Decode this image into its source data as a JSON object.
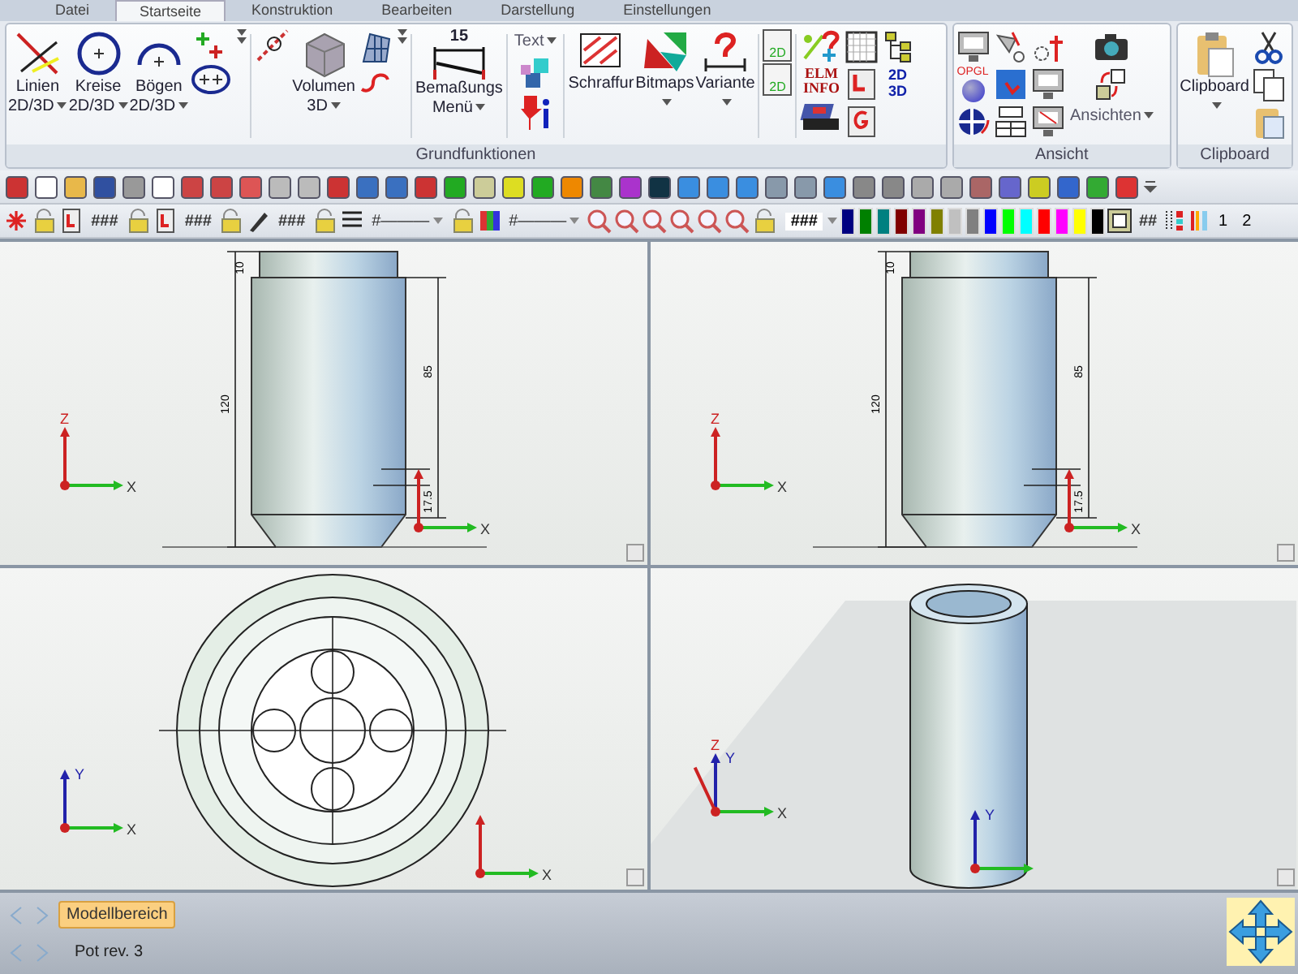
{
  "tabs": [
    {
      "label": "Datei",
      "selected": false
    },
    {
      "label": "Startseite",
      "selected": true
    },
    {
      "label": "Konstruktion",
      "selected": false
    },
    {
      "label": "Bearbeiten",
      "selected": false
    },
    {
      "label": "Darstellung",
      "selected": false
    },
    {
      "label": "Einstellungen",
      "selected": false
    }
  ],
  "ribbon": {
    "groups": [
      {
        "title": "Grundfunktionen"
      },
      {
        "title": "Ansicht"
      },
      {
        "title": "Clipboard"
      }
    ],
    "buttons": [
      {
        "label": "Linien\n2D/3D",
        "dropdown": true
      },
      {
        "label": "Kreise\n2D/3D",
        "dropdown": true
      },
      {
        "label": "Bögen\n2D/3D",
        "dropdown": true
      },
      {
        "label": "Volumen\n3D",
        "dropdown": true
      },
      {
        "label": "Bemaßungs\nMenü",
        "dropdown": true
      },
      {
        "label": "Text",
        "dropdown": true
      },
      {
        "label": "Schraffur",
        "dropdown": false
      },
      {
        "label": "Bitmaps",
        "dropdown": true
      },
      {
        "label": "Variante",
        "dropdown": true
      },
      {
        "label": "Ansichten",
        "dropdown": true
      },
      {
        "label": "Clipboard",
        "dropdown": true
      }
    ],
    "icon_texts": {
      "dimension": "15",
      "doc_a": "2D",
      "doc_b": "2D",
      "elm": "ELM\nINFO",
      "convert_top": "2D",
      "convert_bottom": "3D",
      "opengl": "OPGL"
    }
  },
  "toolbar": {
    "fields": [
      "###",
      "###",
      "###"
    ],
    "line_styles": [
      "#———",
      "#———"
    ],
    "zoom_field": "###",
    "swatches": [
      {
        "color": "#000080"
      },
      {
        "color": "#008000"
      },
      {
        "color": "#008080"
      },
      {
        "color": "#800000"
      },
      {
        "color": "#800080"
      },
      {
        "color": "#808000"
      },
      {
        "color": "#c0c0c0"
      },
      {
        "color": "#808080"
      },
      {
        "color": "#0000ff"
      },
      {
        "color": "#00ff00"
      },
      {
        "color": "#00ffff"
      },
      {
        "color": "#ff0000"
      },
      {
        "color": "#ff00ff"
      },
      {
        "color": "#ffff00"
      },
      {
        "color": "#000000"
      }
    ],
    "grid_label": "##",
    "page_a": "1",
    "page_b": "2"
  },
  "viewports": [
    {
      "kind": "front",
      "dims": [
        "10",
        "120",
        "85",
        "17.5"
      ],
      "triads": [
        {
          "z": "Z",
          "x": "X"
        },
        {
          "x": "X"
        }
      ]
    },
    {
      "kind": "front",
      "dims": [
        "10",
        "120",
        "85",
        "17.5"
      ],
      "triads": [
        {
          "z": "Z",
          "x": "X"
        },
        {
          "x": "X"
        }
      ]
    },
    {
      "kind": "plan",
      "triads": [
        {
          "y": "Y",
          "x": "X"
        },
        {
          "x": "X"
        }
      ]
    },
    {
      "kind": "iso",
      "triads": [
        {
          "z": "Z",
          "y": "Y",
          "x": "X"
        },
        {
          "y": "Y"
        }
      ]
    }
  ],
  "sheet_tabs": [
    {
      "label": "Modellbereich",
      "selected": true
    }
  ],
  "status": "Pot rev. 3"
}
